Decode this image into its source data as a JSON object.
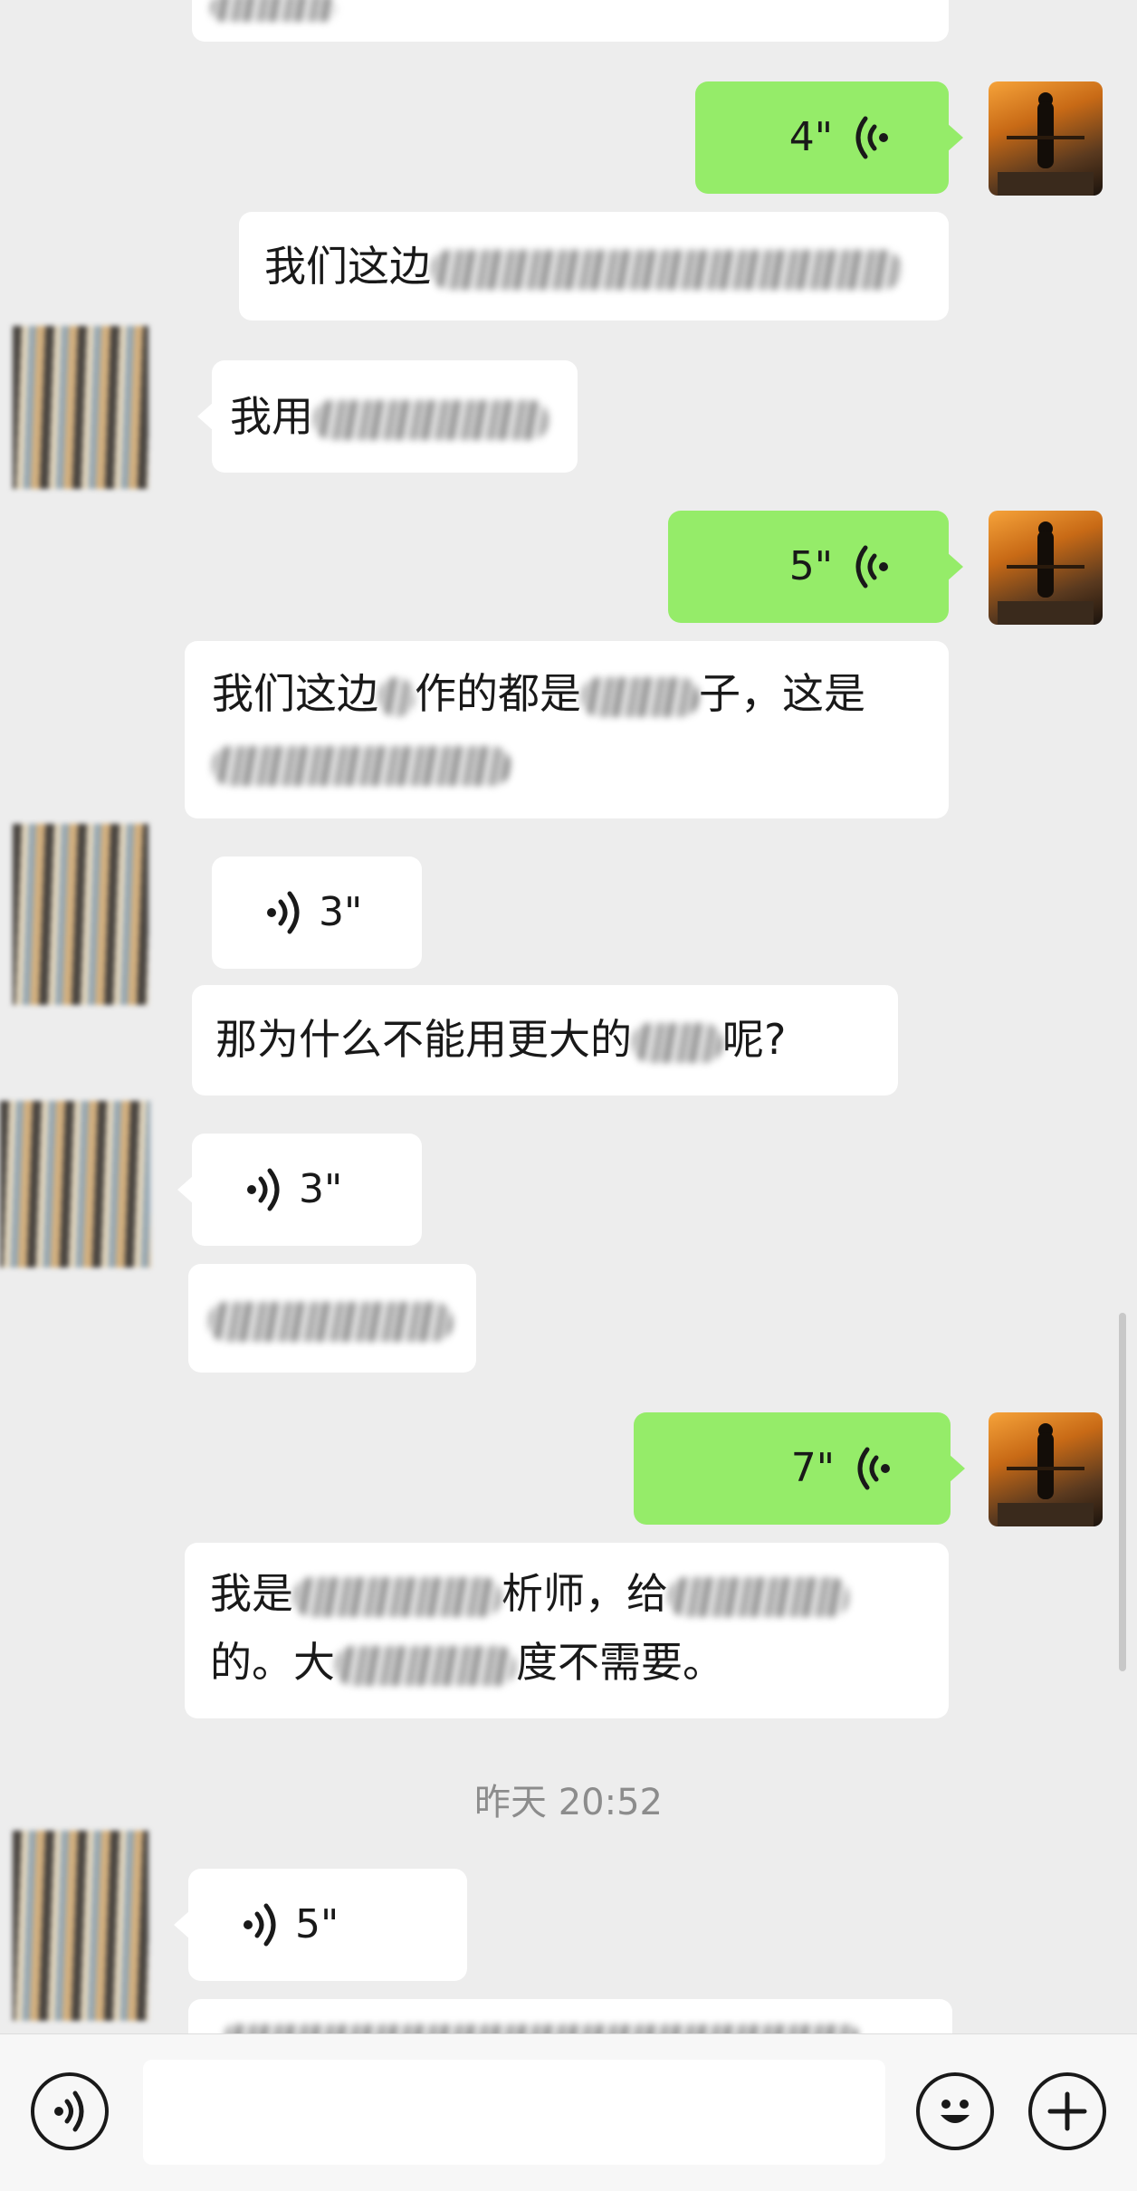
{
  "messages": [
    {
      "id": "m1",
      "side": "outgoing",
      "type": "voice",
      "duration": "4\""
    },
    {
      "id": "m2",
      "side": "incoming",
      "type": "text",
      "text": "我们这边"
    },
    {
      "id": "m3",
      "side": "incoming",
      "type": "text",
      "text": "我用"
    },
    {
      "id": "m4",
      "side": "outgoing",
      "type": "voice",
      "duration": "5\""
    },
    {
      "id": "m5",
      "side": "incoming",
      "type": "text",
      "line1_a": "我们这边",
      "line1_b": "作的都是",
      "line1_c": "子，这是"
    },
    {
      "id": "m6",
      "side": "incoming",
      "type": "voice",
      "duration": "3\""
    },
    {
      "id": "m7",
      "side": "incoming",
      "type": "text",
      "text_a": "那为什么不能用更大的",
      "text_b": "呢?"
    },
    {
      "id": "m8",
      "side": "incoming",
      "type": "voice",
      "duration": "3\""
    },
    {
      "id": "m9",
      "side": "incoming",
      "type": "text",
      "text": ""
    },
    {
      "id": "m10",
      "side": "outgoing",
      "type": "voice",
      "duration": "7\""
    },
    {
      "id": "m11",
      "side": "incoming",
      "type": "text",
      "line1_a": "我是",
      "line1_b": "析师，给",
      "line2_a": "的。大",
      "line2_b": "度不需要。"
    },
    {
      "id": "m12",
      "side": "incoming",
      "type": "voice",
      "duration": "5\""
    }
  ],
  "timestamp": "昨天 20:52",
  "input_bar": {
    "voice_icon": "voice-mode-icon",
    "emoji_icon": "emoji-icon",
    "plus_icon": "plus-icon",
    "input_value": ""
  },
  "colors": {
    "outgoing_bubble": "#95ec69",
    "incoming_bubble": "#ffffff",
    "background": "#ededed"
  }
}
